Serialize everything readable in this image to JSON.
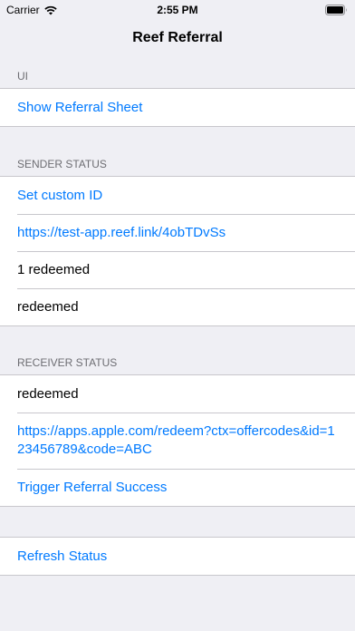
{
  "status_bar": {
    "carrier": "Carrier",
    "time": "2:55 PM"
  },
  "nav": {
    "title": "Reef Referral"
  },
  "sections": {
    "ui": {
      "header": "UI",
      "show_sheet": "Show Referral Sheet"
    },
    "sender": {
      "header": "SENDER STATUS",
      "set_custom_id": "Set custom ID",
      "link": "https://test-app.reef.link/4obTDvSs",
      "redeemed_count": "1 redeemed",
      "status": "redeemed"
    },
    "receiver": {
      "header": "RECEIVER STATUS",
      "status": "redeemed",
      "offer_link": "https://apps.apple.com/redeem?ctx=offercodes&id=123456789&code=ABC",
      "trigger_success": "Trigger Referral Success"
    },
    "actions": {
      "refresh": "Refresh Status"
    }
  },
  "colors": {
    "accent": "#007aff",
    "background": "#efeff4",
    "separator": "#c8c7cc"
  },
  "icons": [
    "wifi-icon",
    "battery-icon"
  ]
}
